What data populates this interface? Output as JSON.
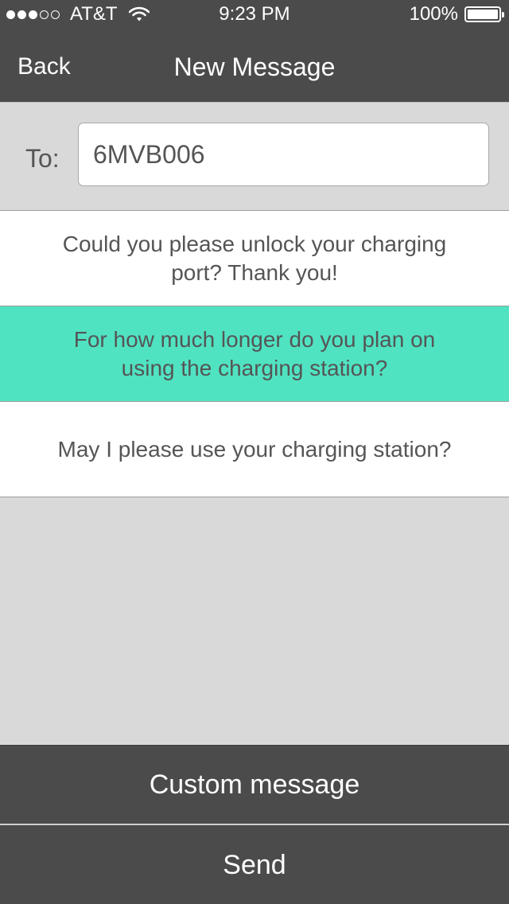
{
  "status_bar": {
    "signal_bars_full": 3,
    "signal_bars_total": 5,
    "carrier": "AT&T",
    "wifi_icon": "wifi-icon",
    "time": "9:23 PM",
    "battery_percent": "100%",
    "battery_level": 1.0
  },
  "nav": {
    "back_label": "Back",
    "title": "New Message"
  },
  "recipient": {
    "label": "To:",
    "value": "6MVB006",
    "placeholder": ""
  },
  "messages": [
    {
      "text": "Could you please unlock your charging port? Thank you!",
      "selected": false
    },
    {
      "text": "For how much longer do you plan on using the charging station?",
      "selected": true
    },
    {
      "text": "May I please use your charging station?",
      "selected": false
    }
  ],
  "actions": {
    "custom_label": "Custom message",
    "send_label": "Send"
  },
  "colors": {
    "bar_background": "#4b4b4b",
    "selected_accent": "#50e3c2",
    "page_background": "#d9d9d9"
  }
}
